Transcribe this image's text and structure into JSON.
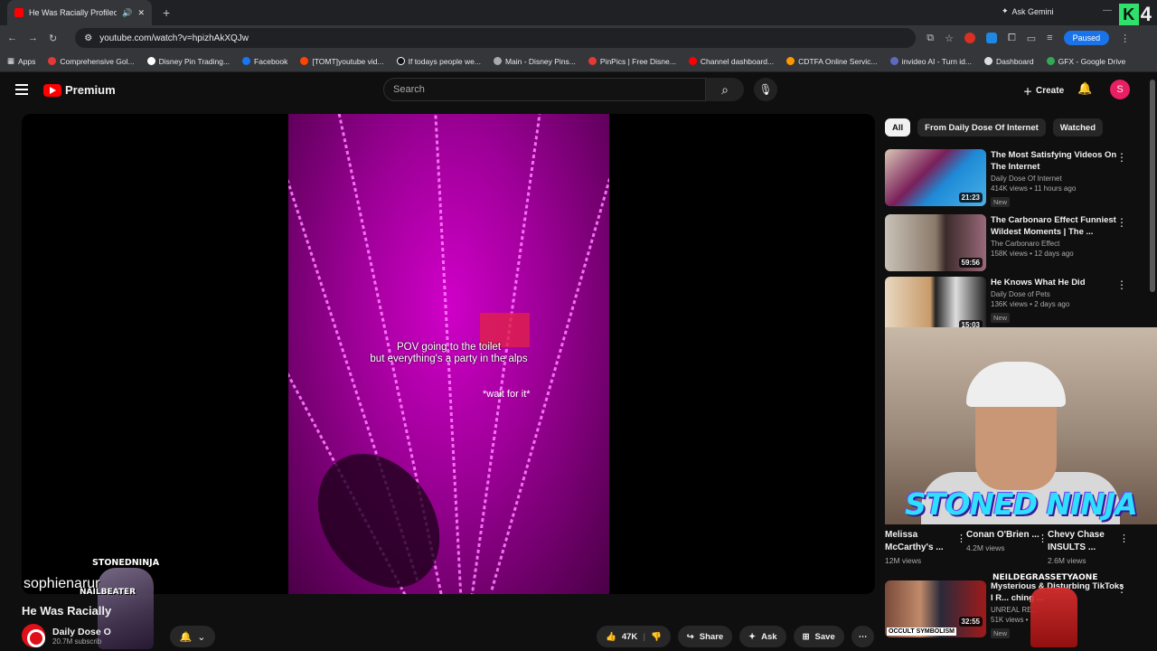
{
  "browser": {
    "tab_title": "He Was Racially Profiled - Y",
    "new_tab": "+",
    "ask_gemini": "Ask Gemini",
    "badge_letter": "K",
    "badge_number": "4",
    "url": "youtube.com/watch?v=hpizhAkXQJw",
    "profile_status": "Paused",
    "bookmarks": [
      "Apps",
      "Comprehensive Gol...",
      "Disney Pin Trading...",
      "Facebook",
      "[TOMT]youtube vid...",
      "If todays people we...",
      "Main - Disney Pins...",
      "PinPics | Free Disne...",
      "Channel dashboard...",
      "CDTFA Online Servic...",
      "invideo AI - Turn id...",
      "Dashboard",
      "GFX - Google Drive"
    ]
  },
  "header": {
    "logo_text": "Premium",
    "search_placeholder": "Search",
    "create_label": "Create",
    "avatar_letter": "S"
  },
  "player": {
    "caption_line1": "POV going to the toilet",
    "caption_line2": "but everything's a party in the alps",
    "caption_wait": "*wait for it*",
    "overlay_stonedninja": "STONEDNINJA",
    "overlay_username": "sophienarur",
    "overlay_nailbeater": "NAILBEATER"
  },
  "video": {
    "title": "He Was Racially",
    "channel_name": "Daily Dose O",
    "channel_subs": "20.7M subscrib",
    "likes": "47K",
    "share_label": "Share",
    "ask_label": "Ask",
    "save_label": "Save"
  },
  "chips": [
    "All",
    "From Daily Dose Of Internet",
    "Watched"
  ],
  "recommendations": [
    {
      "title": "The Most Satisfying Videos On The Internet",
      "channel": "Daily Dose Of Internet",
      "meta": "414K views • 11 hours ago",
      "badge": "New",
      "duration": "21:23"
    },
    {
      "title": "The Carbonaro Effect Funniest Wildest Moments | The ...",
      "channel": "The Carbonaro Effect",
      "meta": "158K views • 12 days ago",
      "badge": "",
      "duration": "59:56"
    },
    {
      "title": "He Knows What He Did",
      "channel": "Daily Dose of Pets",
      "meta": "136K views • 2 days ago",
      "badge": "New",
      "duration": "15:03"
    }
  ],
  "webcam_overlay": "STONED NINJA",
  "shorts": [
    {
      "title": "Melissa McCarthy's ...",
      "views": "12M views"
    },
    {
      "title": "Conan O'Brien ...",
      "views": "4.2M views"
    },
    {
      "title": "Chevy Chase INSULTS ...",
      "views": "2.6M views"
    }
  ],
  "last_rec": {
    "title": "Mysterious & Disturbing TikToks I R... ching ...",
    "channel": "UNREAL RE...",
    "meta": "51K views •",
    "badge": "New",
    "duration": "32:55",
    "thumb_caption": "OCCULT SYMBOLISM",
    "overlay_name": "NEILDEGRASSETYAONE"
  }
}
